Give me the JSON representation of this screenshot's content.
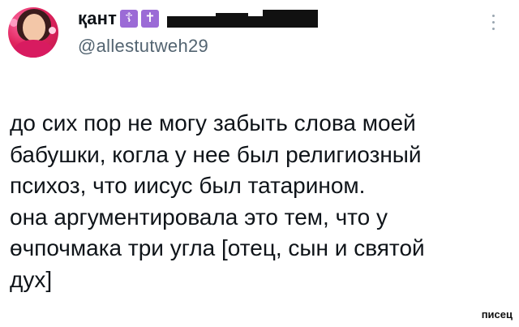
{
  "tweet": {
    "author": {
      "display_name": "қант",
      "emoji_1": "☦",
      "emoji_2": "✝",
      "handle": "@allestutweh29",
      "avatar_icon": "profile-photo"
    },
    "text_lines": [
      "до сих пор не могу забыть слова моей",
      "бабушки, когла у нее был религиозный",
      "психоз, что иисус был татарином.",
      "она аргументировала это тем, что у",
      "өчпочмака три угла [отец, сын и святой",
      "дух]"
    ],
    "menu_icon": "more-vertical-icon"
  },
  "watermark": "писец"
}
